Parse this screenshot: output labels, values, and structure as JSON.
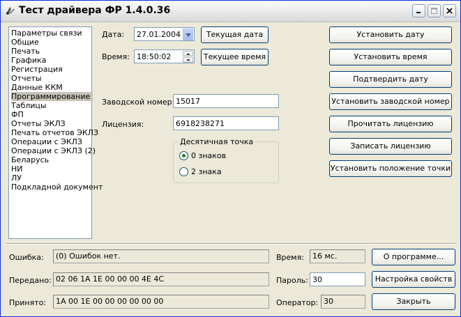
{
  "window": {
    "title": "Тест драйвера ФР 1.4.0.36"
  },
  "sidebar": {
    "items": [
      {
        "label": "Параметры связи"
      },
      {
        "label": "Общие"
      },
      {
        "label": "Печать"
      },
      {
        "label": "Графика"
      },
      {
        "label": "Регистрация"
      },
      {
        "label": "Отчеты"
      },
      {
        "label": "Данные ККМ"
      },
      {
        "label": "Программирование"
      },
      {
        "label": "Таблицы"
      },
      {
        "label": "ФП"
      },
      {
        "label": "Отчеты ЭКЛЗ"
      },
      {
        "label": "Печать отчетов ЭКЛЗ"
      },
      {
        "label": "Операции с ЭКЛЗ"
      },
      {
        "label": "Операции с ЭКЛЗ (2)"
      },
      {
        "label": "Беларусь"
      },
      {
        "label": "НИ"
      },
      {
        "label": "ЛУ"
      },
      {
        "label": "Подкладной документ"
      }
    ],
    "selected_label": "Программирование"
  },
  "main": {
    "date_label": "Дата:",
    "date_value": "27.01.2004",
    "time_label": "Время:",
    "time_value": "18:50:02",
    "current_date_button": "Текущая дата",
    "current_time_button": "Текущее время",
    "serial_label": "Заводской номер:",
    "serial_value": "15017",
    "license_label": "Лицензия:",
    "license_value": "6918238271",
    "decimal_group_title": "Десятичная точка",
    "decimal_options": [
      {
        "label": "0 знаков",
        "selected": true
      },
      {
        "label": "2 знака",
        "selected": false
      }
    ]
  },
  "actions": {
    "set_date": "Установить дату",
    "set_time": "Установить время",
    "confirm_date": "Подтвердить дату",
    "set_serial": "Установить заводской номер",
    "read_license": "Прочитать лицензию",
    "write_license": "Записать лицензию",
    "set_point_position": "Установить положение точки"
  },
  "status": {
    "error_label": "Ошибка:",
    "error_value": "(0) Ошибок нет.",
    "sent_label": "Передано:",
    "sent_value": "02 06 1A 1E 00 00 00 4E 4C",
    "received_label": "Принято:",
    "received_value": "1A 00 1E 00 00 00 00 00 00",
    "time_label": "Время:",
    "time_value": "16 мс.",
    "password_label": "Пароль:",
    "password_value": "30",
    "operator_label": "Оператор:",
    "operator_value": "30"
  },
  "bottom_buttons": {
    "about": "О программе...",
    "settings": "Настройка свойств",
    "close": "Закрыть"
  }
}
